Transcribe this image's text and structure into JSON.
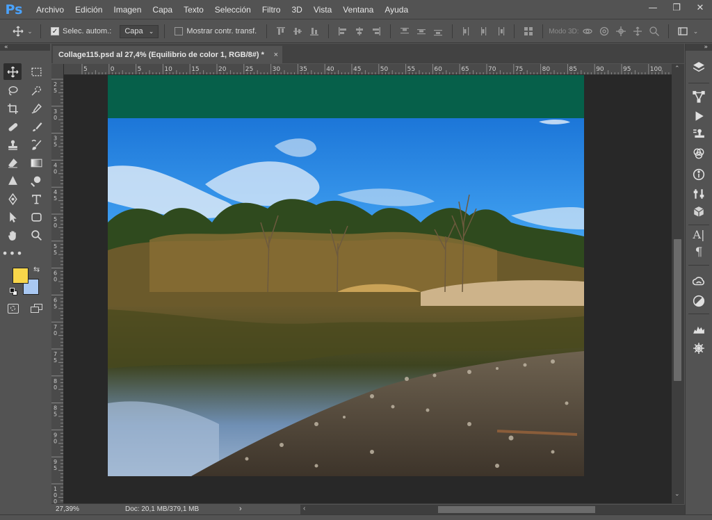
{
  "app": {
    "logo": "Ps"
  },
  "menu": [
    {
      "label": "Archivo"
    },
    {
      "label": "Edición"
    },
    {
      "label": "Imagen"
    },
    {
      "label": "Capa"
    },
    {
      "label": "Texto"
    },
    {
      "label": "Selección"
    },
    {
      "label": "Filtro"
    },
    {
      "label": "3D"
    },
    {
      "label": "Vista"
    },
    {
      "label": "Ventana"
    },
    {
      "label": "Ayuda"
    }
  ],
  "window_controls": {
    "minimize": "—",
    "restore": "❐",
    "close": "✕"
  },
  "options": {
    "auto_select_label": "Selec. autom.:",
    "auto_select_checked": true,
    "auto_select_target": "Capa",
    "show_transform_label": "Mostrar contr. transf.",
    "show_transform_checked": false,
    "mode3d_label": "Modo 3D:"
  },
  "document": {
    "tab_title": "Collage115.psd al 27,4% (Equilibrio de color 1, RGB/8#) *",
    "close_glyph": "×",
    "zoom": "27,39%",
    "doc_info": "Doc: 20,1 MB/379,1 MB"
  },
  "rulers": {
    "top_labels": [
      "5",
      "0",
      "5",
      "10",
      "15",
      "20",
      "25",
      "30",
      "35",
      "40",
      "45",
      "50",
      "55",
      "60",
      "65",
      "70",
      "75",
      "80",
      "85",
      "90",
      "95",
      "100"
    ],
    "left_labels": [
      "2 5",
      "3 0",
      "3 5",
      "4 0",
      "4 5",
      "5 0",
      "5 5",
      "6 0",
      "6 5",
      "7 0",
      "7 5",
      "8 0",
      "8 5",
      "9 0",
      "9 5",
      "1 0 0"
    ]
  },
  "colors": {
    "banner_green": "#06604a",
    "foreground_swatch": "#f8d64a",
    "background_swatch": "#a9c8f2",
    "accent_blue": "#4aa3ff"
  },
  "panels": {
    "collapse_left": "«",
    "collapse_right": "»"
  },
  "icons": {
    "tools": [
      "move-icon",
      "marquee-icon",
      "lasso-icon",
      "quick-select-icon",
      "crop-icon",
      "eyedropper-icon",
      "healing-icon",
      "brush-icon",
      "stamp-icon",
      "history-brush-icon",
      "eraser-icon",
      "gradient-icon",
      "blur-icon",
      "dodge-icon",
      "pen-icon",
      "type-icon",
      "path-select-icon",
      "shape-icon",
      "hand-icon",
      "zoom-icon",
      "more-tools-icon"
    ],
    "dock": [
      "layers-icon",
      "paths-icon",
      "actions-icon",
      "clone-source-icon",
      "channels-icon",
      "info-icon",
      "properties-icon",
      "3d-icon",
      "character-icon",
      "paragraph-icon",
      "libraries-icon",
      "adjustments-icon",
      "histogram-icon",
      "navigator-icon"
    ]
  }
}
